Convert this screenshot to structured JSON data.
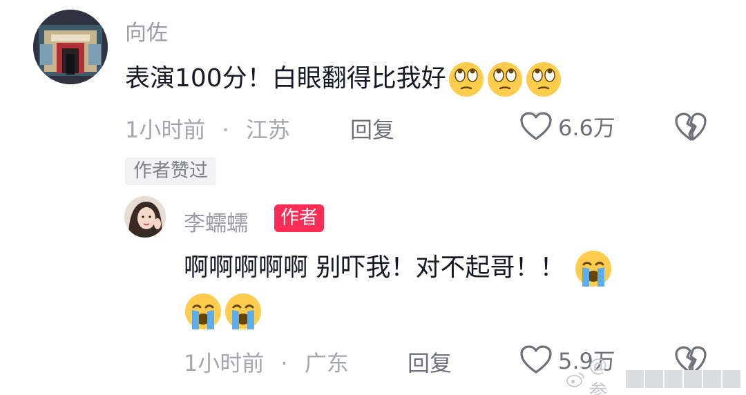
{
  "comment": {
    "username": "向佐",
    "text": "表演100分！白眼翻得比我好",
    "emojis": [
      "eye-roll-emoji",
      "eye-roll-emoji",
      "eye-roll-emoji"
    ],
    "time": "1小时前",
    "separator": "·",
    "location": "江苏",
    "reply_label": "回复",
    "likes": "6.6万",
    "liked_tag": "作者赞过"
  },
  "reply": {
    "username": "李蠕蠕",
    "badge": "作者",
    "text_line1": "啊啊啊啊啊 别吓我！对不起哥！！",
    "emojis_line1": [
      "crying-emoji"
    ],
    "emojis_line2": [
      "crying-emoji",
      "crying-emoji"
    ],
    "time": "1小时前",
    "separator": "·",
    "location": "广东",
    "reply_label": "回复",
    "likes": "5.9万"
  },
  "watermark": {
    "prefix": "@参"
  },
  "colors": {
    "accent": "#fe2c55",
    "emoji_yellow": "#ffcc4d",
    "tear_blue": "#5dadec",
    "meta_gray": "#a4a6ad"
  }
}
